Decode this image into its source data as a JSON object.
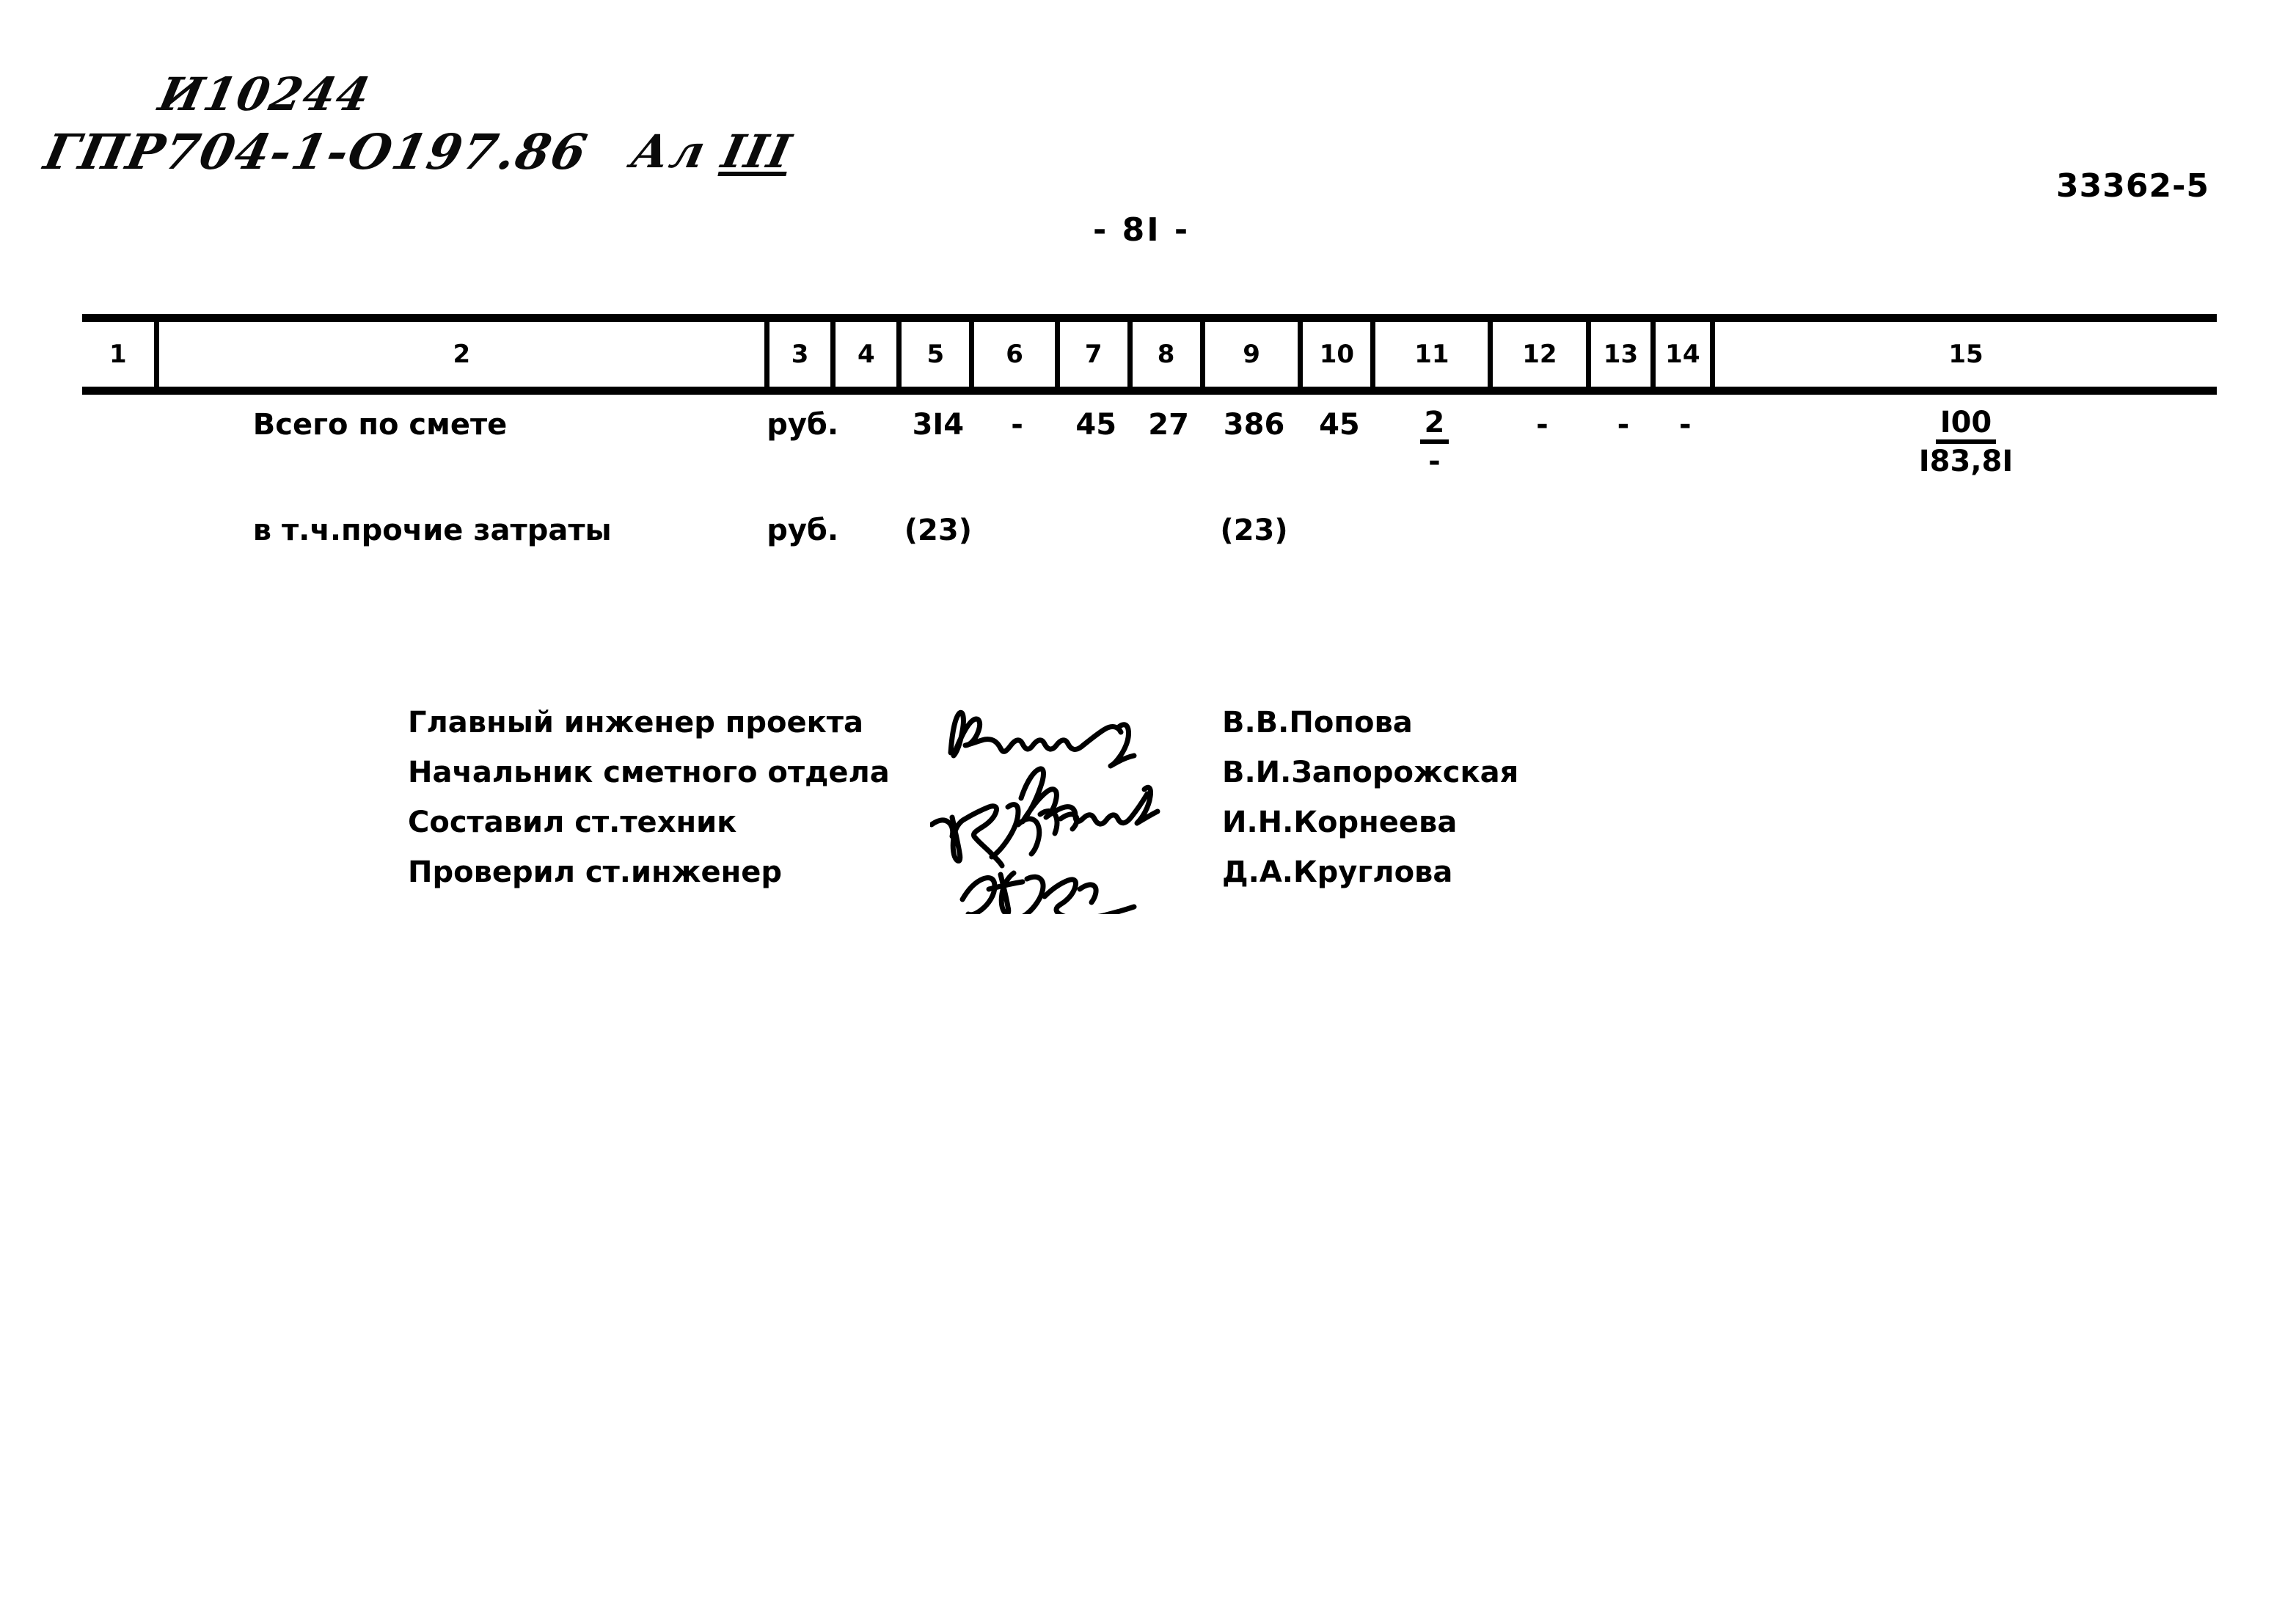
{
  "header": {
    "handwritten_index": "И10244",
    "handwritten_code": "ГПР704-1-О197.86",
    "handwritten_album_prefix": "Ал ",
    "handwritten_album_roman": "III",
    "stamp_number": "33362-5",
    "page_number": "- 8I -"
  },
  "table": {
    "column_headers": [
      "1",
      "2",
      "3",
      "4",
      "5",
      "6",
      "7",
      "8",
      "9",
      "10",
      "11",
      "12",
      "13",
      "14",
      "15"
    ],
    "rows": [
      {
        "name": "total-row",
        "col1": "",
        "col2": "Всего по смете",
        "col3": "руб.",
        "col4": "",
        "col5": "3I4",
        "col6": "-",
        "col7": "45",
        "col8": "27",
        "col9": "386",
        "col10": "45",
        "col11_num": "2",
        "col11_den": "-",
        "col12": "-",
        "col13": "-",
        "col14": "-",
        "col15_num": "I00",
        "col15_den": "I83,8I"
      },
      {
        "name": "other-costs-row",
        "col1": "",
        "col2": "в т.ч.прочие затраты",
        "col3": "руб.",
        "col4": "",
        "col5": "(23)",
        "col6": "",
        "col7": "",
        "col8": "",
        "col9": "(23)",
        "col10": "",
        "col11": "",
        "col12": "",
        "col13": "",
        "col14": "",
        "col15": ""
      }
    ]
  },
  "signatures": [
    {
      "role": "Главный инженер проекта",
      "name": "В.В.Попова"
    },
    {
      "role": "Начальник сметного отдела",
      "name": "В.И.Запорожская"
    },
    {
      "role": "Составил ст.техник",
      "name": "И.Н.Корнеева"
    },
    {
      "role": "Проверил ст.инженер",
      "name": "Д.А.Круглова"
    }
  ],
  "colors": {
    "ink": "#000000",
    "paper": "#ffffff"
  }
}
